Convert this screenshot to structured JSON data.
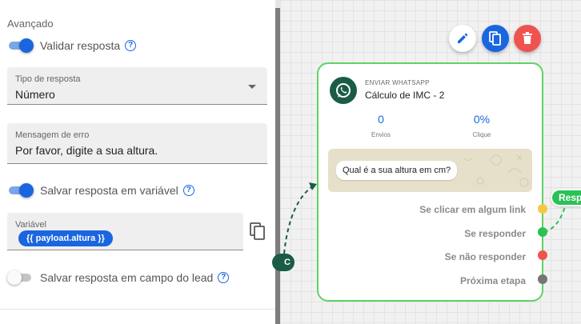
{
  "settings": {
    "section_title": "Avançado",
    "validate_toggle": {
      "label": "Validar resposta",
      "on": true
    },
    "response_type": {
      "label": "Tipo de resposta",
      "value": "Número"
    },
    "error_message": {
      "label": "Mensagem de erro",
      "value": "Por favor, digite a sua altura."
    },
    "save_variable_toggle": {
      "label": "Salvar resposta em variável",
      "on": true
    },
    "variable": {
      "label": "Variável",
      "chip": "{{ payload.altura }}"
    },
    "save_lead_toggle": {
      "label": "Salvar resposta em campo do lead",
      "on": false
    }
  },
  "node": {
    "type": "ENVIAR WHATSAPP",
    "title": "Cálculo de IMC - 2",
    "stats": [
      {
        "value": "0",
        "label": "Envios"
      },
      {
        "value": "0%",
        "label": "Clique"
      }
    ],
    "message": "Qual é a sua altura em cm?",
    "outlets": [
      {
        "label": "Se clicar em algum link",
        "color": "#f6c744"
      },
      {
        "label": "Se responder",
        "color": "#2bc155"
      },
      {
        "label": "Se não responder",
        "color": "#ef5350"
      },
      {
        "label": "Próxima etapa",
        "color": "#757575"
      }
    ]
  },
  "node_actions": [
    {
      "name": "edit",
      "color": "#ffffff"
    },
    {
      "name": "duplicate",
      "color": "#1a66e0"
    },
    {
      "name": "delete",
      "color": "#ef5350"
    }
  ],
  "edge_tags": {
    "right": "Resp",
    "left": "C"
  },
  "colors": {
    "accent": "#1a66e0",
    "node_border": "#5fd364",
    "whatsapp": "#1a5c46"
  }
}
